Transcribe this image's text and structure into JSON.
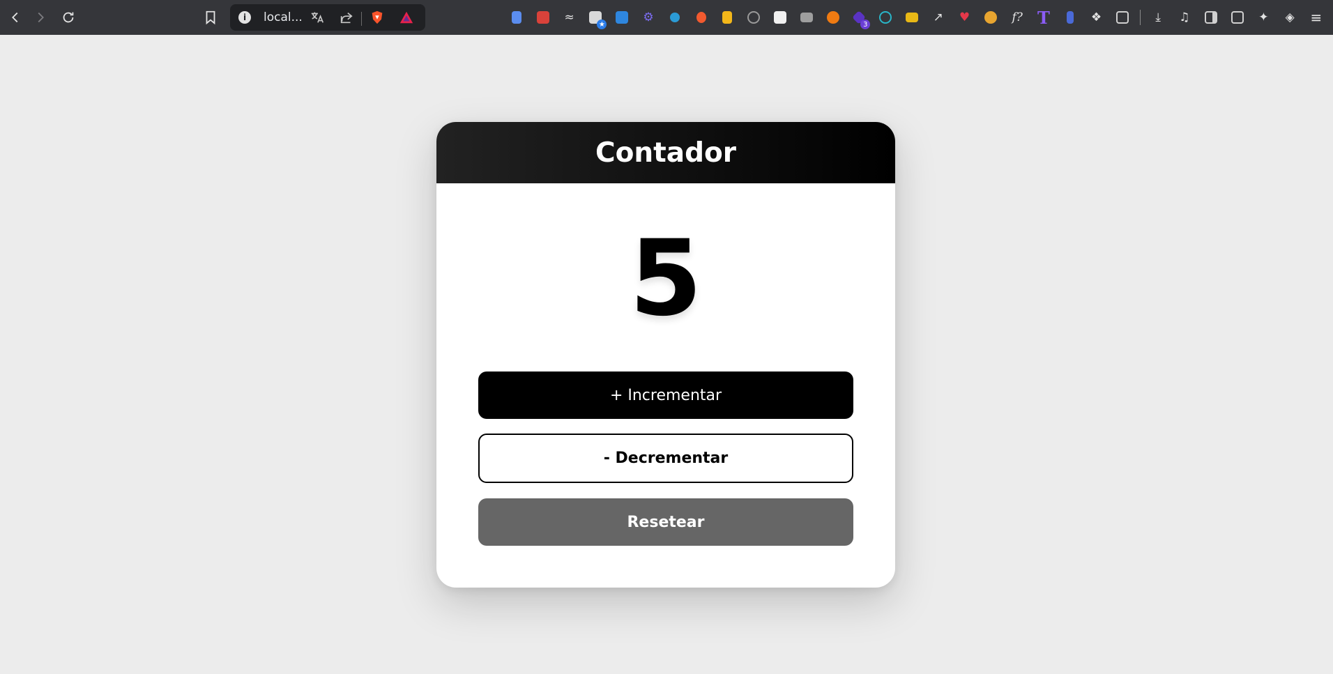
{
  "browser": {
    "url_text": "local...",
    "extension_badge": "3",
    "extension_icons": [
      "docs-icon",
      "code-icon",
      "translate-tool-icon",
      "window-star-icon",
      "fi-icon",
      "gear-ext-icon",
      "bubble-icon",
      "fire-icon",
      "yellow-box-icon",
      "compass-icon",
      "editor-icon",
      "camera-icon",
      "orange-arrow-icon",
      "purple-gem-icon",
      "react-icon",
      "folder-yellow-icon",
      "eyedropper-icon",
      "broken-heart-icon",
      "gear-dark-icon",
      "font-question-icon",
      "text-t-icon",
      "lock-tag-icon",
      "puzzle-icon",
      "screen-search-icon"
    ],
    "ext_glyphs": {
      "font_question": "f?",
      "text_t": "T"
    }
  },
  "app": {
    "title": "Contador",
    "count": "5",
    "buttons": {
      "increment": "+ Incrementar",
      "decrement": "- Decrementar",
      "reset": "Resetear"
    }
  },
  "colors": {
    "header_start": "#222222",
    "header_end": "#000000",
    "increment_bg": "#000000",
    "reset_bg": "#666666",
    "page_bg": "#ececec"
  }
}
